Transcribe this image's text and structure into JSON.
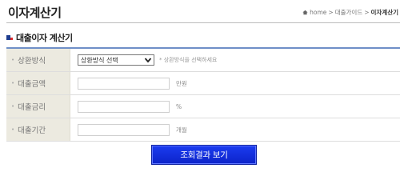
{
  "header": {
    "title": "이자계산기",
    "breadcrumb": [
      "home",
      "대출가이드",
      "이자계산기"
    ],
    "breadcrumb_sep": ">"
  },
  "section": {
    "title": "대출이자 계산기"
  },
  "form": {
    "repayment": {
      "label": "상환방식",
      "selected": "상환방식 선택",
      "helper": "* 상환방식을 선택하세요"
    },
    "amount": {
      "label": "대출금액",
      "value": "",
      "unit": "만원"
    },
    "rate": {
      "label": "대출금리",
      "value": "",
      "unit": "%"
    },
    "period": {
      "label": "대출기간",
      "value": "",
      "unit": "개월"
    }
  },
  "submit": {
    "label": "조회결과 보기"
  },
  "colors": {
    "accent": "#6f8fc7",
    "button": "#1b3cf0",
    "label_bg": "#eceae0",
    "heading_square": "#1e3d8f",
    "heading_dot": "#e02b2b"
  }
}
